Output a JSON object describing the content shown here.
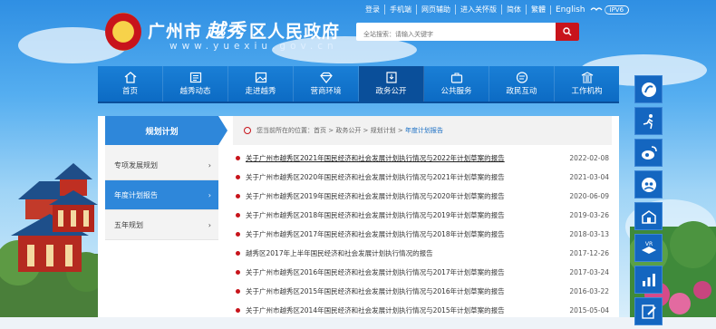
{
  "header": {
    "title_left": "广州市",
    "title_calli": "越秀",
    "title_right": "区人民政府",
    "url": "www.yuexiu.gov.cn",
    "toplinks": [
      "登录",
      "手机端",
      "网页辅助",
      "进入关怀版",
      "简体",
      "繁體",
      "English"
    ],
    "ipv6": "IPV6",
    "search_placeholder": "全站搜索：请输入关键字"
  },
  "nav": [
    {
      "label": "首页",
      "icon": "home-icon"
    },
    {
      "label": "越秀动态",
      "icon": "news-icon"
    },
    {
      "label": "走进越秀",
      "icon": "picture-icon"
    },
    {
      "label": "营商环境",
      "icon": "diamond-icon"
    },
    {
      "label": "政务公开",
      "icon": "document-icon",
      "active": true
    },
    {
      "label": "公共服务",
      "icon": "briefcase-icon"
    },
    {
      "label": "政民互动",
      "icon": "chat-icon"
    },
    {
      "label": "工作机构",
      "icon": "building-icon"
    }
  ],
  "sidebar": {
    "title": "规划计划",
    "items": [
      {
        "label": "专项发展规划"
      },
      {
        "label": "年度计划报告",
        "active": true
      },
      {
        "label": "五年规划"
      }
    ]
  },
  "breadcrumb": {
    "prefix": "您当前所在的位置：",
    "items": [
      "首页",
      "政务公开",
      "规划计划",
      "年度计划报告"
    ]
  },
  "articles": [
    {
      "title": "关于广州市越秀区2021年国民经济和社会发展计划执行情况与2022年计划草案的报告",
      "date": "2022-02-08"
    },
    {
      "title": "关于广州市越秀区2020年国民经济和社会发展计划执行情况与2021年计划草案的报告",
      "date": "2021-03-04"
    },
    {
      "title": "关于广州市越秀区2019年国民经济和社会发展计划执行情况与2020年计划草案的报告",
      "date": "2020-06-09"
    },
    {
      "title": "关于广州市越秀区2018年国民经济和社会发展计划执行情况与2019年计划草案的报告",
      "date": "2019-03-26"
    },
    {
      "title": "关于广州市越秀区2017年国民经济和社会发展计划执行情况与2018年计划草案的报告",
      "date": "2018-03-13"
    },
    {
      "title": "越秀区2017年上半年国民经济和社会发展计划执行情况的报告",
      "date": "2017-12-26"
    },
    {
      "title": "关于广州市越秀区2016年国民经济和社会发展计划执行情况与2017年计划草案的报告",
      "date": "2017-03-24"
    },
    {
      "title": "关于广州市越秀区2015年国民经济和社会发展计划执行情况与2016年计划草案的报告",
      "date": "2016-03-22"
    },
    {
      "title": "关于广州市越秀区2014年国民经济和社会发展计划执行情况与2015年计划草案的报告",
      "date": "2015-05-04"
    }
  ],
  "rightbar": [
    {
      "icon": "yuexiu-logo-icon"
    },
    {
      "icon": "run-icon"
    },
    {
      "icon": "weibo-icon"
    },
    {
      "icon": "people-icon"
    },
    {
      "icon": "building-vr-icon"
    },
    {
      "icon": "vr-icon",
      "label": "VR"
    },
    {
      "icon": "chart-icon"
    },
    {
      "icon": "edit-icon"
    }
  ]
}
